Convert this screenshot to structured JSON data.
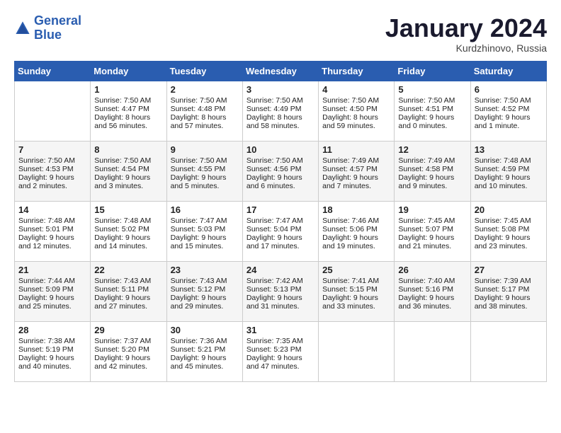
{
  "header": {
    "logo_line1": "General",
    "logo_line2": "Blue",
    "month_title": "January 2024",
    "subtitle": "Kurdzhinovo, Russia"
  },
  "days_of_week": [
    "Sunday",
    "Monday",
    "Tuesday",
    "Wednesday",
    "Thursday",
    "Friday",
    "Saturday"
  ],
  "weeks": [
    [
      {
        "day": "",
        "info": ""
      },
      {
        "day": "1",
        "info": "Sunrise: 7:50 AM\nSunset: 4:47 PM\nDaylight: 8 hours\nand 56 minutes."
      },
      {
        "day": "2",
        "info": "Sunrise: 7:50 AM\nSunset: 4:48 PM\nDaylight: 8 hours\nand 57 minutes."
      },
      {
        "day": "3",
        "info": "Sunrise: 7:50 AM\nSunset: 4:49 PM\nDaylight: 8 hours\nand 58 minutes."
      },
      {
        "day": "4",
        "info": "Sunrise: 7:50 AM\nSunset: 4:50 PM\nDaylight: 8 hours\nand 59 minutes."
      },
      {
        "day": "5",
        "info": "Sunrise: 7:50 AM\nSunset: 4:51 PM\nDaylight: 9 hours\nand 0 minutes."
      },
      {
        "day": "6",
        "info": "Sunrise: 7:50 AM\nSunset: 4:52 PM\nDaylight: 9 hours\nand 1 minute."
      }
    ],
    [
      {
        "day": "7",
        "info": "Sunrise: 7:50 AM\nSunset: 4:53 PM\nDaylight: 9 hours\nand 2 minutes."
      },
      {
        "day": "8",
        "info": "Sunrise: 7:50 AM\nSunset: 4:54 PM\nDaylight: 9 hours\nand 3 minutes."
      },
      {
        "day": "9",
        "info": "Sunrise: 7:50 AM\nSunset: 4:55 PM\nDaylight: 9 hours\nand 5 minutes."
      },
      {
        "day": "10",
        "info": "Sunrise: 7:50 AM\nSunset: 4:56 PM\nDaylight: 9 hours\nand 6 minutes."
      },
      {
        "day": "11",
        "info": "Sunrise: 7:49 AM\nSunset: 4:57 PM\nDaylight: 9 hours\nand 7 minutes."
      },
      {
        "day": "12",
        "info": "Sunrise: 7:49 AM\nSunset: 4:58 PM\nDaylight: 9 hours\nand 9 minutes."
      },
      {
        "day": "13",
        "info": "Sunrise: 7:48 AM\nSunset: 4:59 PM\nDaylight: 9 hours\nand 10 minutes."
      }
    ],
    [
      {
        "day": "14",
        "info": "Sunrise: 7:48 AM\nSunset: 5:01 PM\nDaylight: 9 hours\nand 12 minutes."
      },
      {
        "day": "15",
        "info": "Sunrise: 7:48 AM\nSunset: 5:02 PM\nDaylight: 9 hours\nand 14 minutes."
      },
      {
        "day": "16",
        "info": "Sunrise: 7:47 AM\nSunset: 5:03 PM\nDaylight: 9 hours\nand 15 minutes."
      },
      {
        "day": "17",
        "info": "Sunrise: 7:47 AM\nSunset: 5:04 PM\nDaylight: 9 hours\nand 17 minutes."
      },
      {
        "day": "18",
        "info": "Sunrise: 7:46 AM\nSunset: 5:06 PM\nDaylight: 9 hours\nand 19 minutes."
      },
      {
        "day": "19",
        "info": "Sunrise: 7:45 AM\nSunset: 5:07 PM\nDaylight: 9 hours\nand 21 minutes."
      },
      {
        "day": "20",
        "info": "Sunrise: 7:45 AM\nSunset: 5:08 PM\nDaylight: 9 hours\nand 23 minutes."
      }
    ],
    [
      {
        "day": "21",
        "info": "Sunrise: 7:44 AM\nSunset: 5:09 PM\nDaylight: 9 hours\nand 25 minutes."
      },
      {
        "day": "22",
        "info": "Sunrise: 7:43 AM\nSunset: 5:11 PM\nDaylight: 9 hours\nand 27 minutes."
      },
      {
        "day": "23",
        "info": "Sunrise: 7:43 AM\nSunset: 5:12 PM\nDaylight: 9 hours\nand 29 minutes."
      },
      {
        "day": "24",
        "info": "Sunrise: 7:42 AM\nSunset: 5:13 PM\nDaylight: 9 hours\nand 31 minutes."
      },
      {
        "day": "25",
        "info": "Sunrise: 7:41 AM\nSunset: 5:15 PM\nDaylight: 9 hours\nand 33 minutes."
      },
      {
        "day": "26",
        "info": "Sunrise: 7:40 AM\nSunset: 5:16 PM\nDaylight: 9 hours\nand 36 minutes."
      },
      {
        "day": "27",
        "info": "Sunrise: 7:39 AM\nSunset: 5:17 PM\nDaylight: 9 hours\nand 38 minutes."
      }
    ],
    [
      {
        "day": "28",
        "info": "Sunrise: 7:38 AM\nSunset: 5:19 PM\nDaylight: 9 hours\nand 40 minutes."
      },
      {
        "day": "29",
        "info": "Sunrise: 7:37 AM\nSunset: 5:20 PM\nDaylight: 9 hours\nand 42 minutes."
      },
      {
        "day": "30",
        "info": "Sunrise: 7:36 AM\nSunset: 5:21 PM\nDaylight: 9 hours\nand 45 minutes."
      },
      {
        "day": "31",
        "info": "Sunrise: 7:35 AM\nSunset: 5:23 PM\nDaylight: 9 hours\nand 47 minutes."
      },
      {
        "day": "",
        "info": ""
      },
      {
        "day": "",
        "info": ""
      },
      {
        "day": "",
        "info": ""
      }
    ]
  ]
}
